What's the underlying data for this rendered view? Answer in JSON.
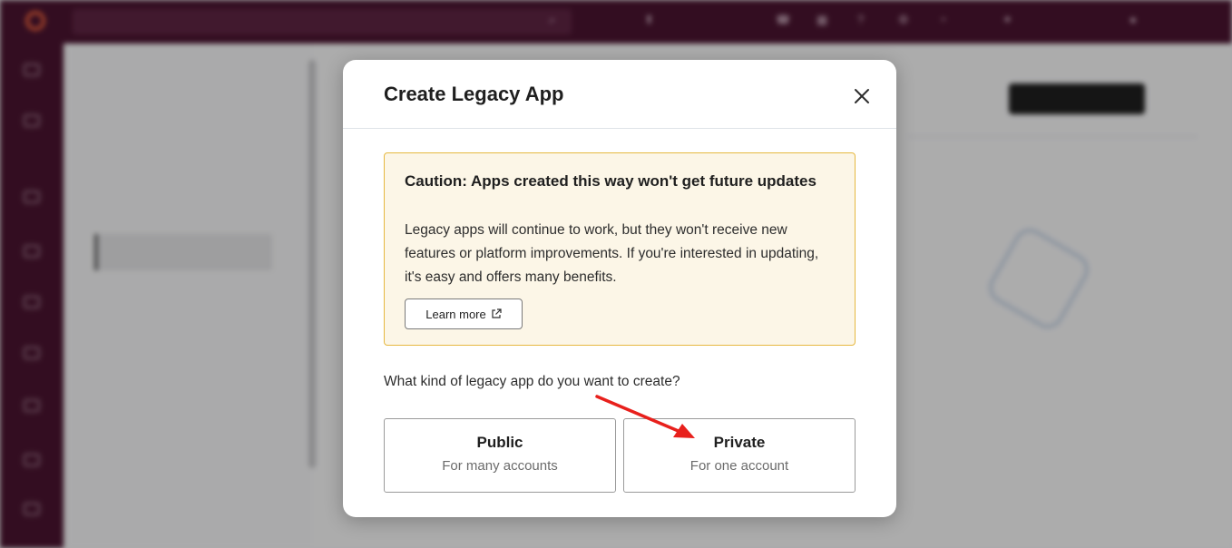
{
  "modal": {
    "title": "Create Legacy App",
    "close_icon": "close-icon",
    "caution": {
      "title": "Caution: Apps created this way won't get future updates",
      "body": "Legacy apps will continue to work, but they won't receive new features or platform improvements. If you're interested in updating, it's easy and offers many benefits.",
      "learn_more_label": "Learn more",
      "learn_more_icon": "external-link-icon",
      "background_color": "#fcf6e7",
      "border_color": "#e6b840"
    },
    "question": "What kind of legacy app do you want to create?",
    "options": [
      {
        "title": "Public",
        "subtitle": "For many accounts"
      },
      {
        "title": "Private",
        "subtitle": "For one account"
      }
    ]
  },
  "annotation": {
    "arrow_color": "#e8201c",
    "points_to": "Private"
  },
  "colors": {
    "topbar": "#4a1430",
    "brand_logo": "#e8603c"
  }
}
